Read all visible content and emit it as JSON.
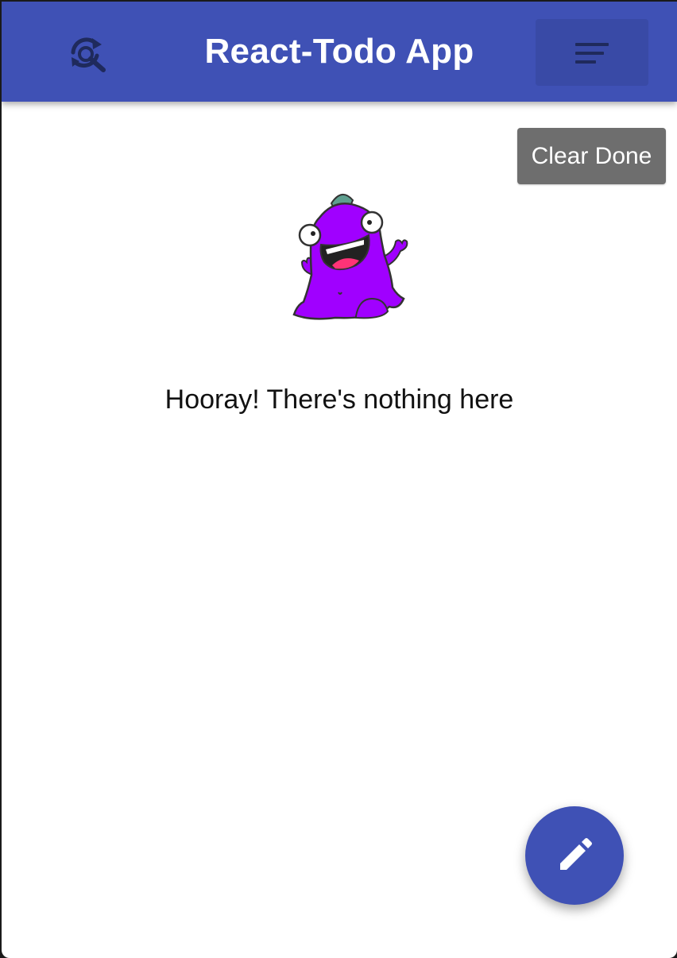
{
  "app": {
    "title": "React-Todo App"
  },
  "toolbar": {
    "search_icon": "search-refresh-icon",
    "menu_icon": "sort-menu-icon"
  },
  "actions": {
    "clear_done_label": "Clear Done",
    "fab_icon": "edit-pencil-icon"
  },
  "empty_state": {
    "illustration": "purple-monster-illustration",
    "message": "Hooray! There's nothing here"
  },
  "colors": {
    "primary": "#3f51b5",
    "primary_dark": "#394aa6",
    "clear_button": "#6e6e6e",
    "icon_dark": "#1f2a5c",
    "monster": "#a000ff"
  }
}
